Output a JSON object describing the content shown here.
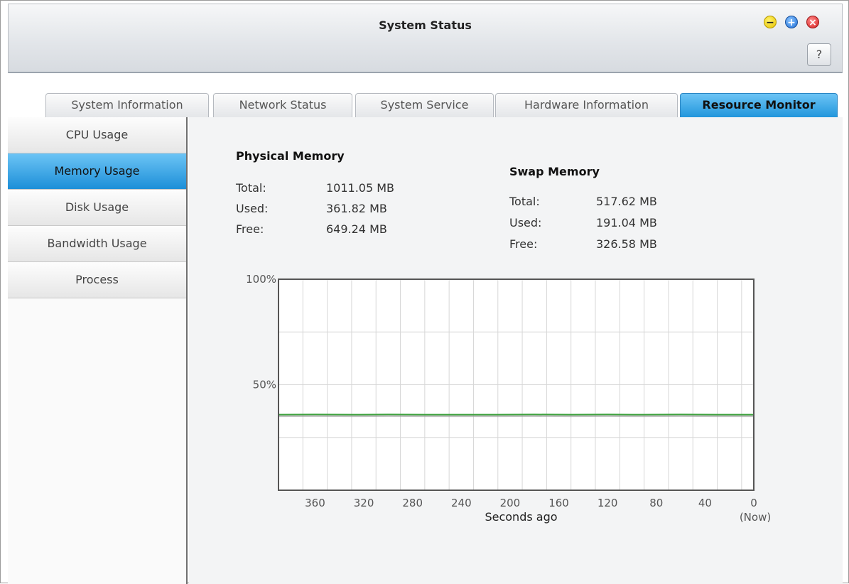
{
  "window": {
    "title": "System Status",
    "help_label": "?",
    "min_glyph": "−",
    "max_glyph": "+",
    "close_glyph": "×"
  },
  "tabs": [
    {
      "label": "System Information"
    },
    {
      "label": "Network Status"
    },
    {
      "label": "System Service"
    },
    {
      "label": "Hardware Information"
    },
    {
      "label": "Resource Monitor",
      "active": true
    }
  ],
  "sidebar": {
    "items": [
      {
        "label": "CPU Usage"
      },
      {
        "label": "Memory Usage",
        "active": true
      },
      {
        "label": "Disk Usage"
      },
      {
        "label": "Bandwidth Usage"
      },
      {
        "label": "Process"
      }
    ]
  },
  "physical": {
    "heading": "Physical Memory",
    "rows": [
      {
        "label": "Total:",
        "value": "1011.05 MB"
      },
      {
        "label": "Used:",
        "value": "361.82 MB"
      },
      {
        "label": "Free:",
        "value": "649.24 MB"
      }
    ]
  },
  "swap": {
    "heading": "Swap Memory",
    "rows": [
      {
        "label": "Total:",
        "value": "517.62 MB"
      },
      {
        "label": "Used:",
        "value": "191.04 MB"
      },
      {
        "label": "Free:",
        "value": "326.58 MB"
      }
    ]
  },
  "chart_data": {
    "type": "line",
    "xlabel": "Seconds ago",
    "x_ticks": [
      "360",
      "320",
      "280",
      "240",
      "200",
      "160",
      "120",
      "80",
      "40",
      "0"
    ],
    "x_now_label": "(Now)",
    "y_ticks": [
      "100%",
      "50%"
    ],
    "ylim": [
      0,
      100
    ],
    "xlim": [
      390,
      0
    ],
    "grid": true,
    "series": [
      {
        "color": "#3da23d",
        "x": [
          390,
          360,
          330,
          300,
          270,
          240,
          210,
          180,
          150,
          120,
          90,
          60,
          30,
          0
        ],
        "values": [
          35.8,
          35.9,
          35.8,
          35.9,
          35.8,
          35.8,
          35.8,
          35.9,
          35.8,
          35.9,
          35.8,
          35.9,
          35.8,
          35.8
        ]
      }
    ]
  },
  "colors": {
    "accent": "#2196dc",
    "series": "#3da23d"
  }
}
